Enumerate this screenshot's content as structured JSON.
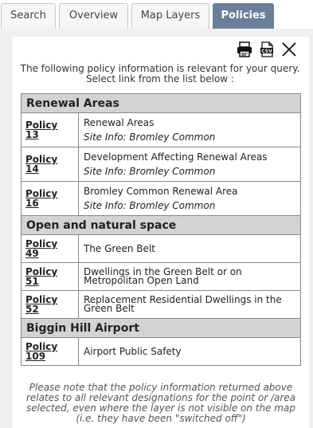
{
  "tabs": [
    {
      "label": "Search",
      "active": false
    },
    {
      "label": "Overview",
      "active": false
    },
    {
      "label": "Map Layers",
      "active": false
    },
    {
      "label": "Policies",
      "active": true
    }
  ],
  "toolbar": {
    "print_icon": "printer-icon",
    "csv_icon": "csv-export-icon",
    "csv_text": "CSV",
    "close_icon": "close-icon"
  },
  "intro": "The following policy information is relevant for your query. Select link from the list below :",
  "groups": [
    {
      "title": "Renewal Areas",
      "rows": [
        {
          "link": "Policy",
          "num": "13",
          "text": "Renewal Areas",
          "site": "Site Info: Bromley Common"
        },
        {
          "link": "Policy",
          "num": "14",
          "text": "Development Affecting Renewal Areas",
          "site": "Site Info: Bromley Common"
        },
        {
          "link": "Policy",
          "num": "16",
          "text": "Bromley Common Renewal Area",
          "site": "Site Info: Bromley Common"
        }
      ]
    },
    {
      "title": "Open and natural space",
      "rows": [
        {
          "link": "Policy",
          "num": "49",
          "text": "The Green Belt"
        },
        {
          "link": "Policy",
          "num": "51",
          "text": "Dwellings in the Green Belt or on Metropolitan Open Land"
        },
        {
          "link": "Policy",
          "num": "52",
          "text": "Replacement Residential Dwellings in the Green Belt"
        }
      ]
    },
    {
      "title": "Biggin Hill Airport",
      "rows": [
        {
          "link": "Policy",
          "num": "109",
          "text": "Airport Public Safety"
        }
      ]
    }
  ],
  "note": "Please note that the policy information returned above relates to all relevant designations for the point or /area selected, even where the layer is not visible on the map (i.e. they have been \"switched off\")",
  "colors": {
    "active_tab": "#6b7f99",
    "group_header": "#d3d3d3",
    "panel_bg": "#f0f0f0"
  }
}
